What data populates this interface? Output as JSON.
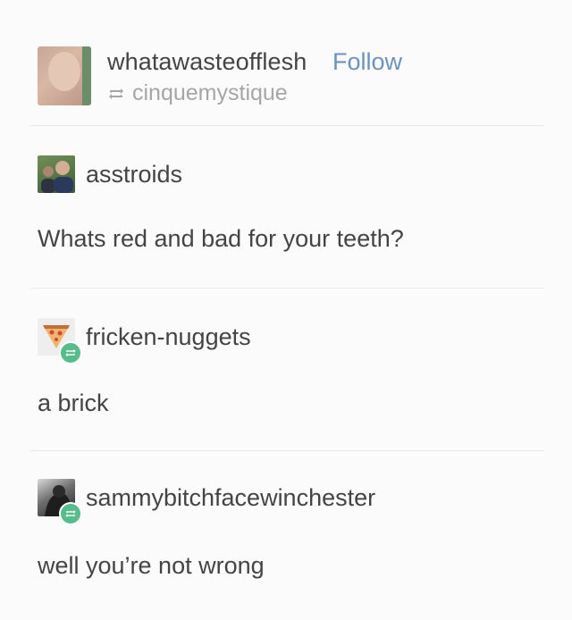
{
  "post": {
    "username": "whatawasteofflesh",
    "follow_label": "Follow",
    "reblogged_from": "cinquemystique"
  },
  "thread": [
    {
      "username": "asstroids",
      "text": "Whats red and bad for your teeth?",
      "reblog_badge": false
    },
    {
      "username": "fricken-nuggets",
      "text": "a brick",
      "reblog_badge": true
    },
    {
      "username": "sammybitchfacewinchester",
      "text": "well you’re not wrong",
      "reblog_badge": true
    }
  ],
  "colors": {
    "follow_link": "#6b93bf",
    "reblog_badge": "#56bc8a",
    "muted_text": "#a6a6a6",
    "primary_text": "#444444"
  }
}
